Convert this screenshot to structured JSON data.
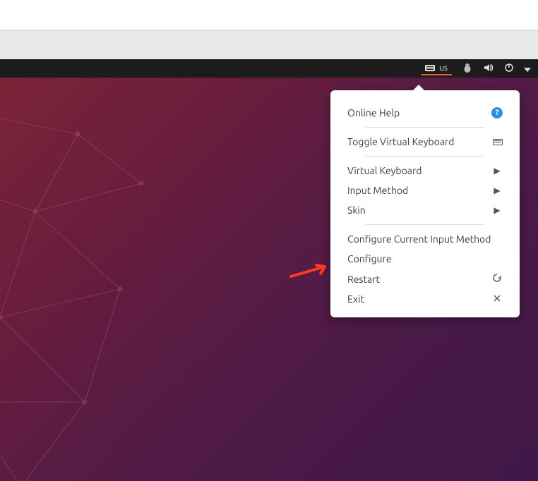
{
  "topbar": {
    "ime_label": "us"
  },
  "menu": {
    "online_help": "Online Help",
    "toggle_vkbd": "Toggle Virtual Keyboard",
    "virtual_keyboard": "Virtual Keyboard",
    "input_method": "Input Method",
    "skin": "Skin",
    "configure_current": "Configure Current Input Method",
    "configure": "Configure",
    "restart": "Restart",
    "exit": "Exit"
  }
}
